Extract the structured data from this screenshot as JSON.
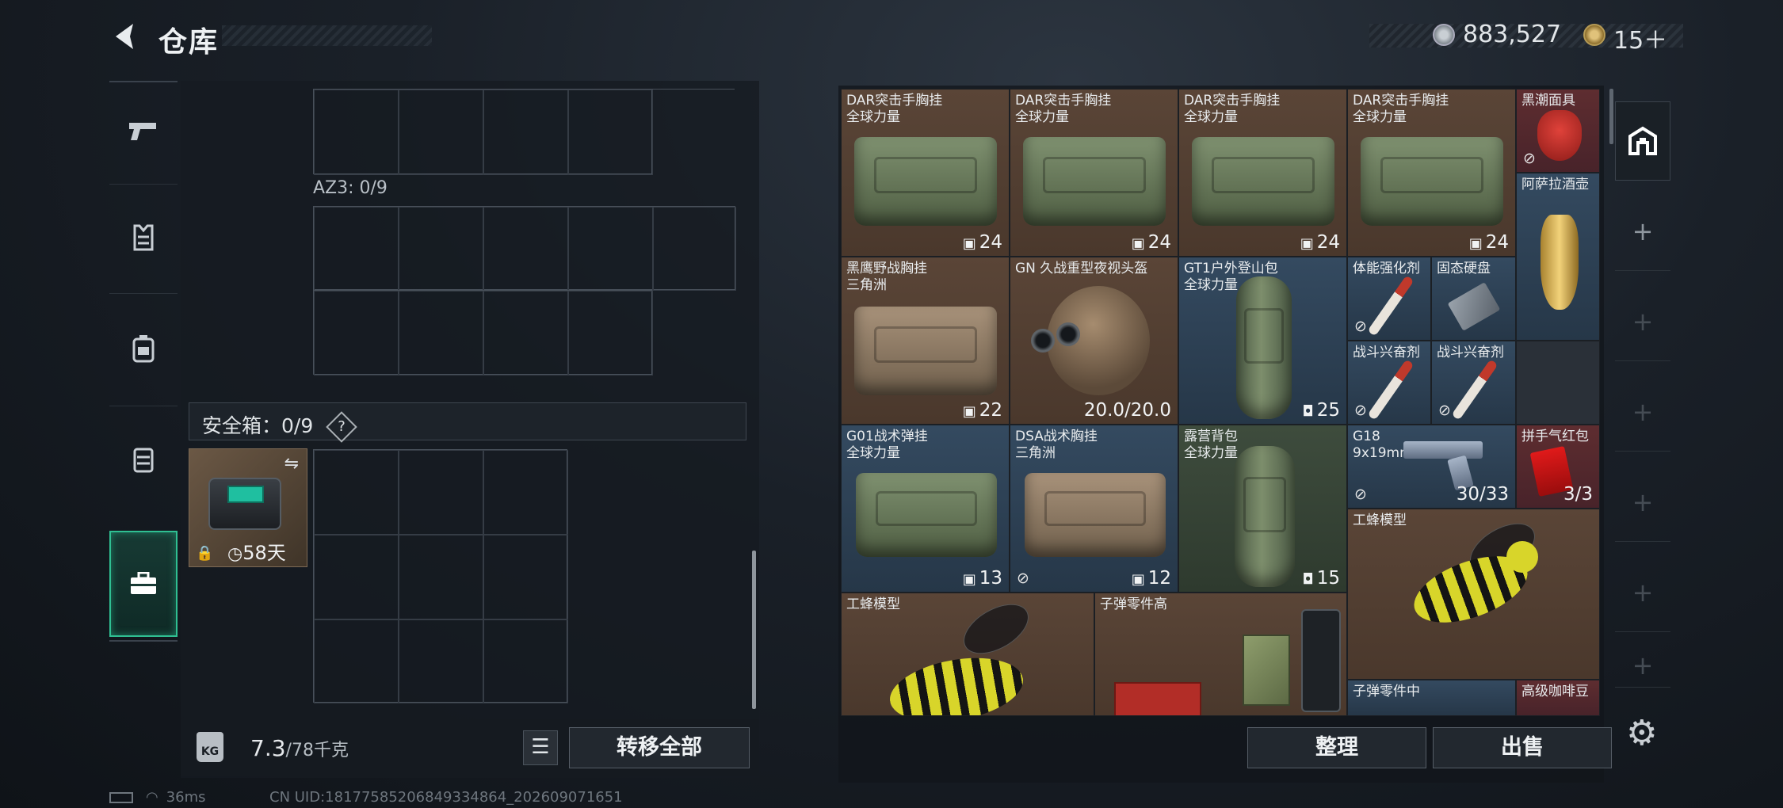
{
  "header": {
    "back_icon": "back-arrow-icon",
    "title": "仓库"
  },
  "currency": {
    "silver": "883,527",
    "gold": "15＋"
  },
  "left": {
    "az3_label": "AZ3: 0/9",
    "safe_label": "安全箱：0/9",
    "safe_help": "?",
    "safe_case": {
      "timer": "58天"
    },
    "weight_value": "7.3",
    "weight_max": "/78千克",
    "kg_icon_text": "KG",
    "transfer_all": "转移全部"
  },
  "nav": {
    "items": [
      "pistol-icon",
      "vest-icon",
      "backpack-icon",
      "rig-icon",
      "case-icon"
    ]
  },
  "items": {
    "i1": {
      "name": "DAR突击手胸挂\n全球力量",
      "count": "24"
    },
    "i2": {
      "name": "DAR突击手胸挂\n全球力量",
      "count": "24"
    },
    "i3": {
      "name": "DAR突击手胸挂\n全球力量",
      "count": "24"
    },
    "i4": {
      "name": "DAR突击手胸挂\n全球力量",
      "count": "24"
    },
    "i5": {
      "name": "黑潮面具"
    },
    "i6": {
      "name": "阿萨拉酒壶"
    },
    "i7": {
      "name": "黑鹰野战胸挂\n三角洲",
      "count": "22"
    },
    "i8": {
      "name": "GN 久战重型夜视头盔",
      "count": "20.0/20.0"
    },
    "i9": {
      "name": "GT1户外登山包\n全球力量",
      "count": "25"
    },
    "i10": {
      "name": "体能强化剂"
    },
    "i11": {
      "name": "固态硬盘"
    },
    "i12": {
      "name": "战斗兴奋剂"
    },
    "i13": {
      "name": "战斗兴奋剂"
    },
    "i14": {
      "name": "G01战术弹挂\n全球力量",
      "count": "13"
    },
    "i15": {
      "name": "DSA战术胸挂\n三角洲",
      "count": "12"
    },
    "i16": {
      "name": "露营背包\n全球力量",
      "count": "15"
    },
    "i17": {
      "name": "G18\n9x19mm",
      "count": "30/33"
    },
    "i18": {
      "name": "拼手气红包",
      "count": "3/3"
    },
    "i19": {
      "name": "工蜂模型"
    },
    "i20": {
      "name": "工蜂模型"
    },
    "i21": {
      "name": "子弹零件高"
    },
    "i22": {
      "name": "子弹零件中"
    },
    "i23": {
      "name": "高级咖啡豆"
    }
  },
  "actions": {
    "sort": "整理",
    "sell": "出售"
  },
  "status": {
    "ping": "36ms",
    "uid": "CN UID:18177585206849334864_202609071651"
  }
}
